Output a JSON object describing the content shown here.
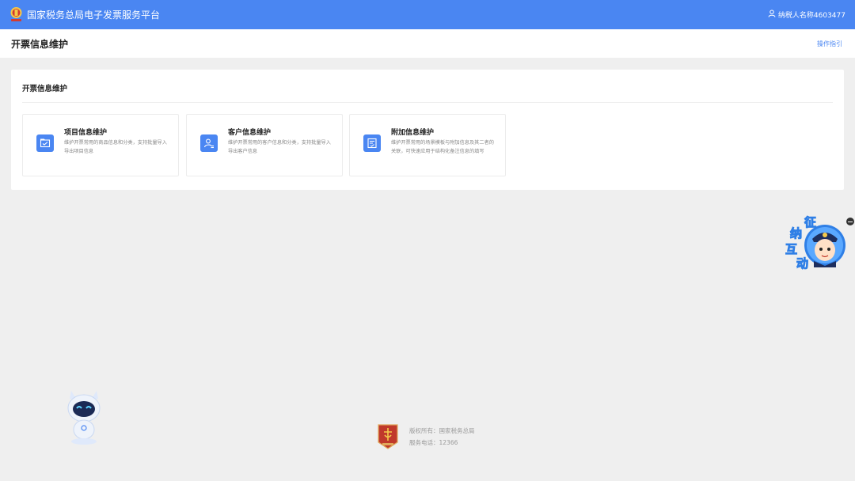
{
  "header": {
    "title": "国家税务总局电子发票服务平台",
    "logo_icon": "tax-emblem-icon",
    "user_icon": "user-icon",
    "user_label": "纳税人名称4603477"
  },
  "page": {
    "title": "开票信息维护",
    "guide_link": "操作指引"
  },
  "panel": {
    "title": "开票信息维护",
    "cards": [
      {
        "icon": "folder-icon",
        "title": "项目信息维护",
        "desc": "维护开票常用的商品信息和分类，支持批量导入导出项目信息"
      },
      {
        "icon": "customer-icon",
        "title": "客户信息维护",
        "desc": "维护开票常用的客户信息和分类，支持批量导入导出客户信息"
      },
      {
        "icon": "note-icon",
        "title": "附加信息维护",
        "desc": "维护开票常用的场景模板与附加信息及其二者的关联，可快速应用于结构化备注信息的填写"
      }
    ]
  },
  "footer": {
    "copyright": "版权所有：国家税务总局",
    "phone": "服务电话：12366"
  },
  "widgets": {
    "interact_chars": [
      "纳",
      "征",
      "互",
      "动"
    ],
    "close_icon": "minus-circle-icon",
    "robot_icon": "robot-assistant-icon"
  },
  "colors": {
    "primary": "#4a86f2",
    "background": "#efefef",
    "emblem_red": "#c0392b"
  }
}
